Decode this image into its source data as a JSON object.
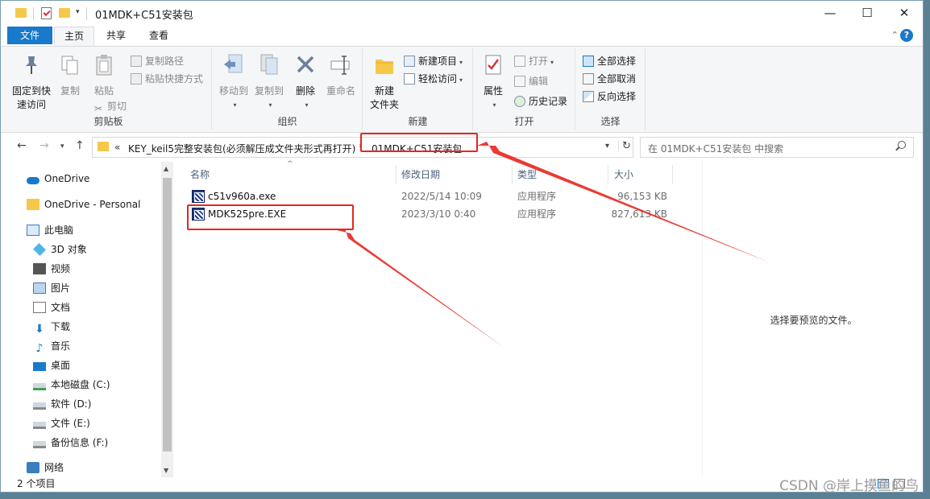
{
  "window": {
    "title": "01MDK+C51安装包",
    "controls": {
      "minimize": "—",
      "maximize": "☐",
      "close": "✕"
    }
  },
  "ribbon_tabs": {
    "file": "文件",
    "home": "主页",
    "share": "共享",
    "view": "查看"
  },
  "ribbon": {
    "clipboard": {
      "pin_label": "固定到快\n速访问",
      "copy": "复制",
      "paste": "粘贴",
      "copy_path": "复制路径",
      "paste_shortcut": "粘贴快捷方式",
      "cut": "剪切",
      "group": "剪贴板"
    },
    "organize": {
      "move_to": "移动到",
      "copy_to": "复制到",
      "delete": "删除",
      "rename": "重命名",
      "group": "组织"
    },
    "new": {
      "new_folder": "新建\n文件夹",
      "new_item": "新建项目",
      "easy_access": "轻松访问",
      "group": "新建"
    },
    "open": {
      "properties": "属性",
      "open": "打开",
      "edit": "编辑",
      "history": "历史记录",
      "group": "打开"
    },
    "select": {
      "select_all": "全部选择",
      "select_none": "全部取消",
      "invert": "反向选择",
      "group": "选择"
    }
  },
  "address": {
    "prefix": "«",
    "parent": "KEY_keil5完整安装包(必须解压成文件夹形式再打开)",
    "current": "01MDK+C51安装包",
    "search_placeholder": "在 01MDK+C51安装包 中搜索"
  },
  "nav_pane": [
    {
      "label": "OneDrive",
      "icon": "cloud-icon"
    },
    {
      "label": "OneDrive - Personal",
      "icon": "folder-icon"
    },
    {
      "label": "此电脑",
      "icon": "computer-icon"
    },
    {
      "label": "3D 对象",
      "icon": "3d-objects-icon"
    },
    {
      "label": "视频",
      "icon": "video-icon"
    },
    {
      "label": "图片",
      "icon": "pictures-icon"
    },
    {
      "label": "文档",
      "icon": "documents-icon"
    },
    {
      "label": "下载",
      "icon": "download-icon"
    },
    {
      "label": "音乐",
      "icon": "music-icon"
    },
    {
      "label": "桌面",
      "icon": "desktop-icon"
    },
    {
      "label": "本地磁盘 (C:)",
      "icon": "drive-c-icon"
    },
    {
      "label": "软件 (D:)",
      "icon": "drive-icon"
    },
    {
      "label": "文件 (E:)",
      "icon": "drive-icon"
    },
    {
      "label": "备份信息 (F:)",
      "icon": "drive-icon"
    },
    {
      "label": "网络",
      "icon": "network-icon"
    }
  ],
  "columns": {
    "name": "名称",
    "date": "修改日期",
    "type": "类型",
    "size": "大小"
  },
  "files": [
    {
      "name": "c51v960a.exe",
      "date": "2022/5/14 10:09",
      "type": "应用程序",
      "size": "96,153 KB"
    },
    {
      "name": "MDK525pre.EXE",
      "date": "2023/3/10 0:40",
      "type": "应用程序",
      "size": "827,613 KB"
    }
  ],
  "preview_text": "选择要预览的文件。",
  "status": {
    "count": "2 个项目"
  },
  "watermark": "CSDN @岸上摸鱼的鸟",
  "colors": {
    "accent": "#1979ca",
    "annotation": "#e8251e",
    "folder": "#f5c84a"
  }
}
